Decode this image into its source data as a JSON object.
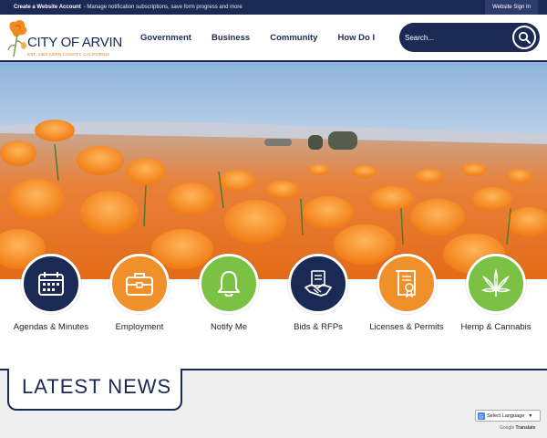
{
  "topbar": {
    "create_label": "Create a Website Account",
    "description": " - Manage notification subscriptions, save form progress and more",
    "signin_label": "Website Sign In"
  },
  "header": {
    "logo_text": "CITY OF ARVIN",
    "logo_tagline": "EST. 1960  KERN COUNTY, CALIFORNIA"
  },
  "nav": {
    "items": [
      "Government",
      "Business",
      "Community",
      "How Do I"
    ]
  },
  "search": {
    "placeholder": "Search..."
  },
  "quick_links": [
    {
      "label": "Agendas & Minutes",
      "icon": "calendar-icon",
      "color": "#1b2a55"
    },
    {
      "label": "Employment",
      "icon": "briefcase-icon",
      "color": "#f0902b"
    },
    {
      "label": "Notify Me",
      "icon": "bell-icon",
      "color": "#7bc143"
    },
    {
      "label": "Bids & RFPs",
      "icon": "handshake-icon",
      "color": "#1b2a55"
    },
    {
      "label": "Licenses & Permits",
      "icon": "certificate-icon",
      "color": "#f0902b"
    },
    {
      "label": "Hemp & Cannabis",
      "icon": "cannabis-leaf-icon",
      "color": "#7bc143"
    }
  ],
  "news": {
    "title": "LATEST NEWS"
  },
  "translate": {
    "select_label": "Select Language",
    "powered_prefix": "Google",
    "powered_word": "Translate"
  },
  "colors": {
    "navy": "#1b2a55",
    "orange": "#f0902b",
    "green": "#7bc143"
  }
}
